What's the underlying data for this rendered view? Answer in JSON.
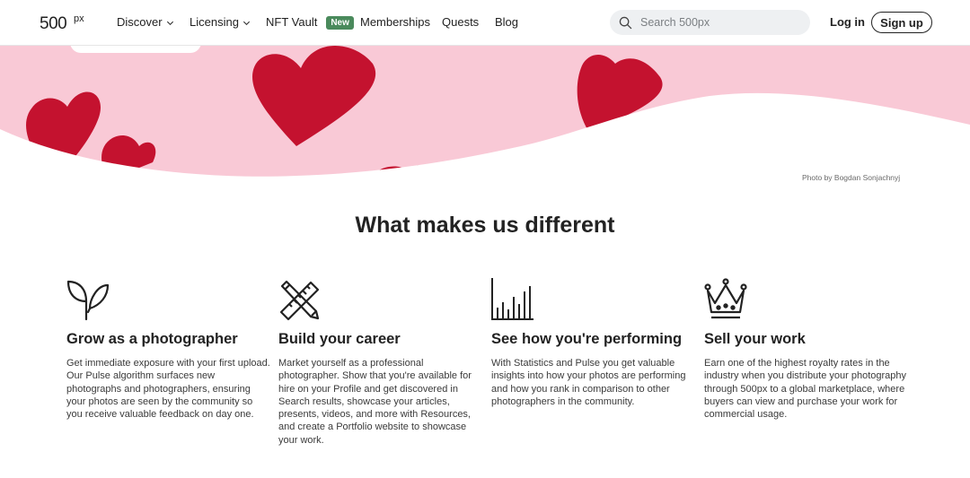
{
  "header": {
    "logo": "500px",
    "nav": [
      {
        "label": "Discover",
        "dropdown": true
      },
      {
        "label": "Licensing",
        "dropdown": true
      },
      {
        "label": "NFT Vault",
        "badge": "New"
      },
      {
        "label": "Memberships"
      },
      {
        "label": "Quests"
      },
      {
        "label": "Blog"
      }
    ],
    "search": {
      "placeholder": "Search 500px"
    },
    "login_label": "Log in",
    "signup_label": "Sign up"
  },
  "hero": {
    "photo_credit": "Photo by Bogdan Sonjachnyj",
    "colors": {
      "background": "#f9c9d6",
      "heart": "#c4122f"
    }
  },
  "features_section": {
    "title": "What makes us different",
    "features": [
      {
        "icon": "sprout-icon",
        "title": "Grow as a photographer",
        "description": "Get immediate exposure with your first upload. Our Pulse algorithm surfaces new photographs and photographers, ensuring your photos are seen by the community so you receive valuable feedback on day one."
      },
      {
        "icon": "ruler-pencil-icon",
        "title": "Build your career",
        "description": "Market yourself as a professional photographer. Show that you're available for hire on your Profile and get discovered in Search results, showcase your articles, presents, videos, and more with Resources, and create a Portfolio website to showcase your work."
      },
      {
        "icon": "bar-chart-icon",
        "title": "See how you're performing",
        "description": "With Statistics and Pulse you get valuable insights into how your photos are performing and how you rank in comparison to other photographers in the community."
      },
      {
        "icon": "crown-icon",
        "title": "Sell your work",
        "description": "Earn one of the highest royalty rates in the industry when you distribute your photography through 500px to a global marketplace, where buyers can view and purchase your work for commercial usage."
      }
    ]
  }
}
